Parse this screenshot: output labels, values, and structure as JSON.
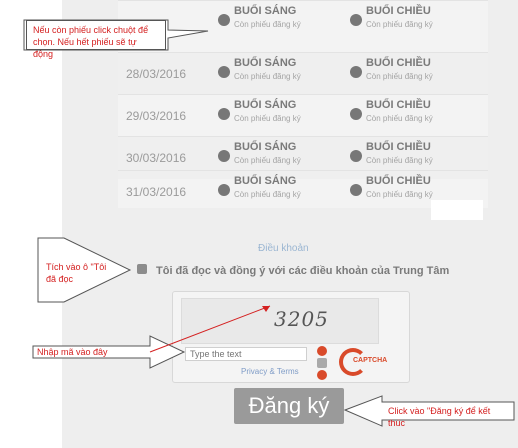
{
  "registration_table": {
    "rows": [
      {
        "date": "",
        "morning": {
          "label": "BUỔI SÁNG",
          "sub": "Còn phiếu đăng ký"
        },
        "afternoon": {
          "label": "BUỔI CHIỀU",
          "sub": "Còn phiếu đăng ký"
        }
      },
      {
        "date": "28/03/2016",
        "morning": {
          "label": "BUỔI SÁNG",
          "sub": "Còn phiếu đăng ký"
        },
        "afternoon": {
          "label": "BUỔI CHIỀU",
          "sub": "Còn phiếu đăng ký"
        }
      },
      {
        "date": "29/03/2016",
        "morning": {
          "label": "BUỔI SÁNG",
          "sub": "Còn phiếu đăng ký"
        },
        "afternoon": {
          "label": "BUỔI CHIỀU",
          "sub": "Còn phiếu đăng ký"
        }
      },
      {
        "date": "30/03/2016",
        "morning": {
          "label": "BUỔI SÁNG",
          "sub": "Còn phiếu đăng ký"
        },
        "afternoon": {
          "label": "BUỔI CHIỀU",
          "sub": "Còn phiếu đăng ký"
        }
      },
      {
        "date": "31/03/2016",
        "morning": {
          "label": "BUỔI SÁNG",
          "sub": "Còn phiếu đăng ký"
        },
        "afternoon": {
          "label": "BUỔI CHIỀU",
          "sub": "Còn phiếu đăng ký"
        }
      }
    ]
  },
  "terms": {
    "link": "Điều khoản",
    "agree_label": "Tôi đã đọc và đồng ý với các điều khoản của Trung Tâm"
  },
  "captcha": {
    "word": "3205",
    "placeholder": "Type the text",
    "privacy": "Privacy & Terms",
    "brand": "CAPTCHA"
  },
  "submit": {
    "label": "Đăng ký"
  },
  "annotations": {
    "top": "Nếu còn phiếu click chuột để chọn. Nếu hết phiếu sẽ tự động",
    "checkbox": "Tích vào ô \"Tôi đã đọc",
    "captcha": "Nhập mã vào đây",
    "submit": "Click vào \"Đăng ký để kết thúc"
  },
  "colors": {
    "annotation_text": "#d42020",
    "arrow": "#d42020",
    "recaptcha_brand": "#d94a2a"
  }
}
